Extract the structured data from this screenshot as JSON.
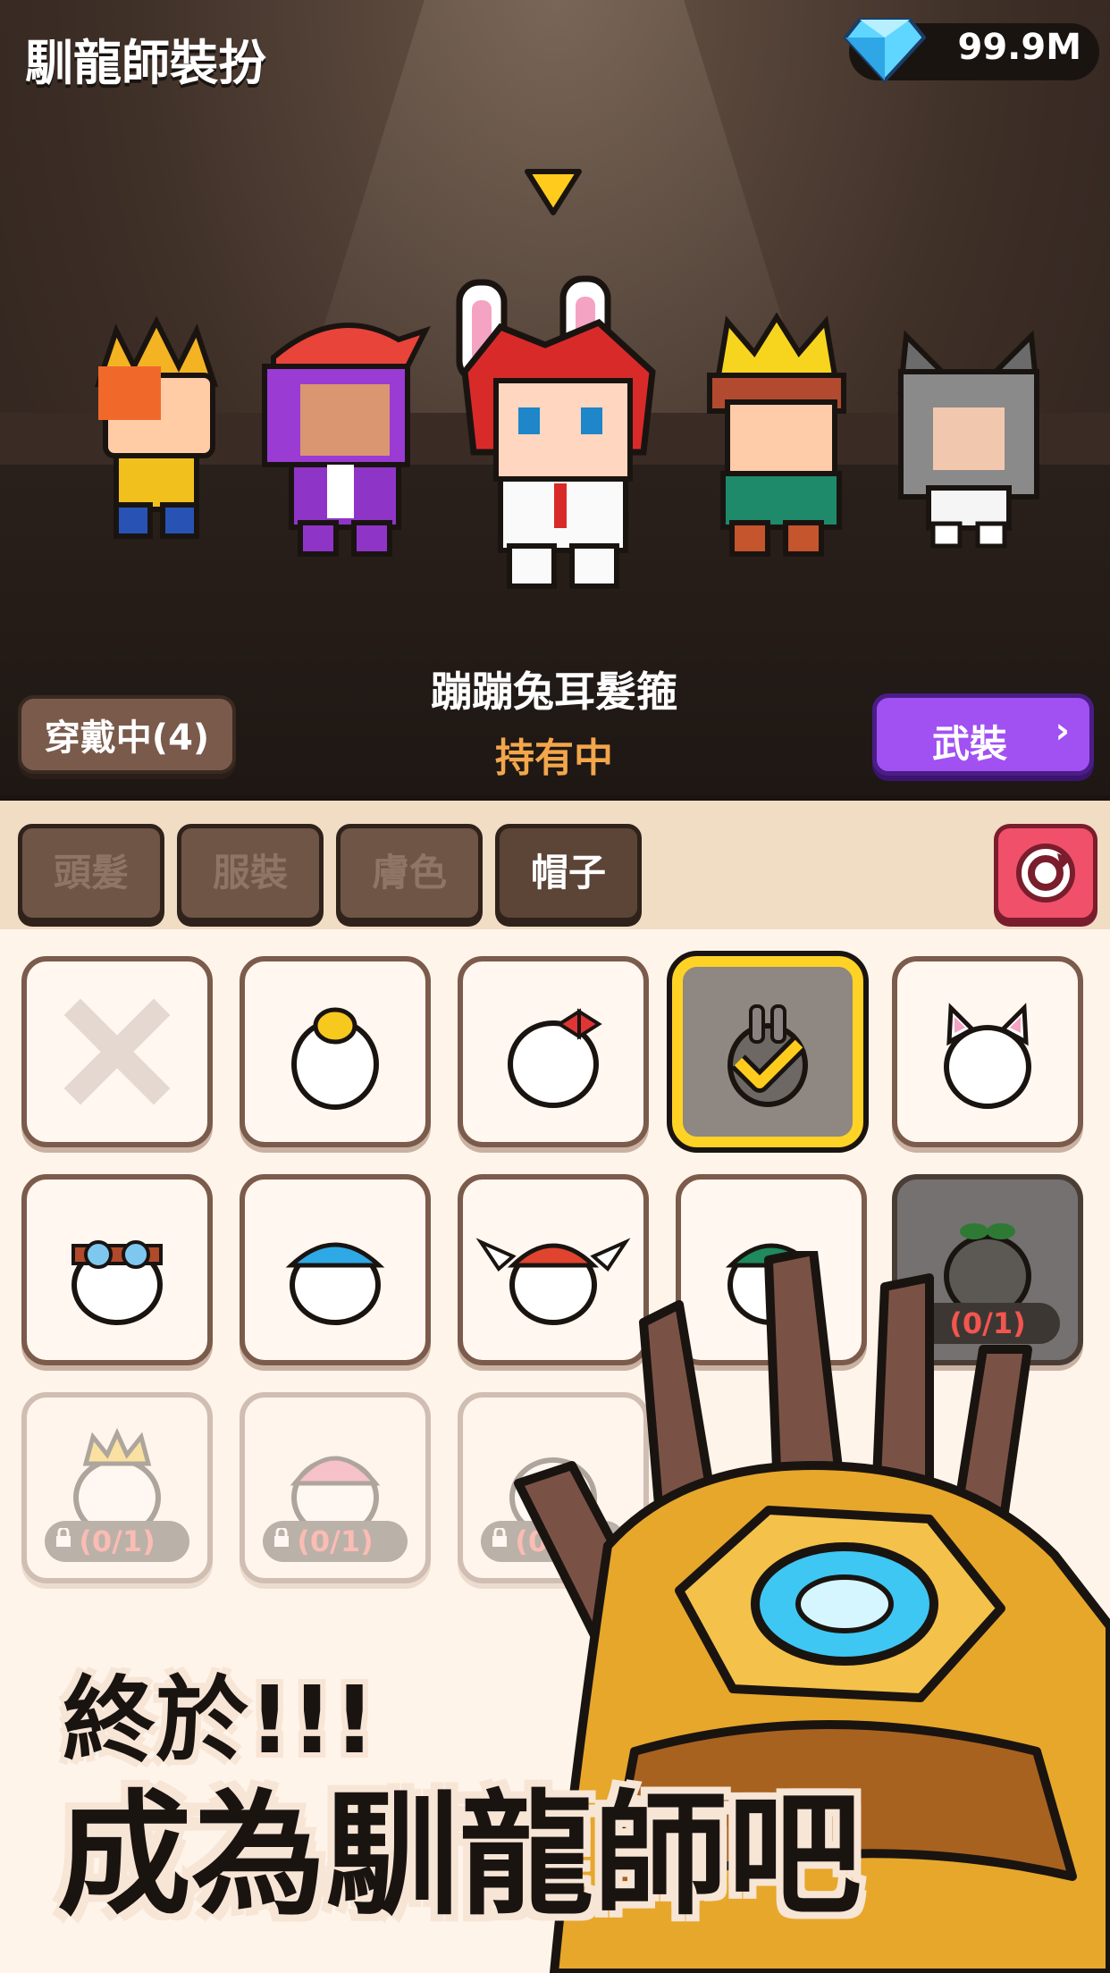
{
  "header": {
    "title": "馴龍師裝扮",
    "gem_value": "99.9M"
  },
  "preview": {
    "item_name": "蹦蹦兔耳髮箍",
    "item_status": "持有中",
    "wearing_button": "穿戴中(4)",
    "weapon_button": "武裝",
    "weapon_arrow": "›"
  },
  "tabs": [
    {
      "label": "頭髮",
      "active": false
    },
    {
      "label": "服裝",
      "active": false
    },
    {
      "label": "膚色",
      "active": false
    },
    {
      "label": "帽子",
      "active": true
    }
  ],
  "items": [
    {
      "id": "none",
      "icon": "x-icon",
      "state": "normal"
    },
    {
      "id": "chick",
      "icon": "chick-hat-icon",
      "state": "normal"
    },
    {
      "id": "bow",
      "icon": "bow-hat-icon",
      "state": "normal"
    },
    {
      "id": "bunny",
      "icon": "bunny-ears-icon",
      "state": "selected"
    },
    {
      "id": "cat",
      "icon": "cat-ears-icon",
      "state": "normal"
    },
    {
      "id": "goggles",
      "icon": "goggles-hat-icon",
      "state": "normal"
    },
    {
      "id": "bluecap",
      "icon": "blue-cap-icon",
      "state": "normal"
    },
    {
      "id": "wingcap",
      "icon": "winged-cap-icon",
      "state": "normal"
    },
    {
      "id": "greencap",
      "icon": "green-cap-icon",
      "state": "normal"
    },
    {
      "id": "sprout",
      "icon": "sprout-hat-icon",
      "state": "disabled",
      "count": "(0/1)"
    },
    {
      "id": "crownlock",
      "icon": "crown-hat-icon",
      "state": "locked",
      "count": "(0/1)"
    },
    {
      "id": "pinklock",
      "icon": "pink-hat-icon",
      "state": "locked",
      "count": "(0/1)"
    },
    {
      "id": "lock3",
      "icon": "hat-icon",
      "state": "locked",
      "count": "(0/1)"
    }
  ],
  "banner": {
    "line1": "終於!!!",
    "line2": "成為馴龍師吧"
  },
  "colors": {
    "accent": "#a150f2",
    "gold": "#ffd226",
    "status": "#f3a64b"
  }
}
